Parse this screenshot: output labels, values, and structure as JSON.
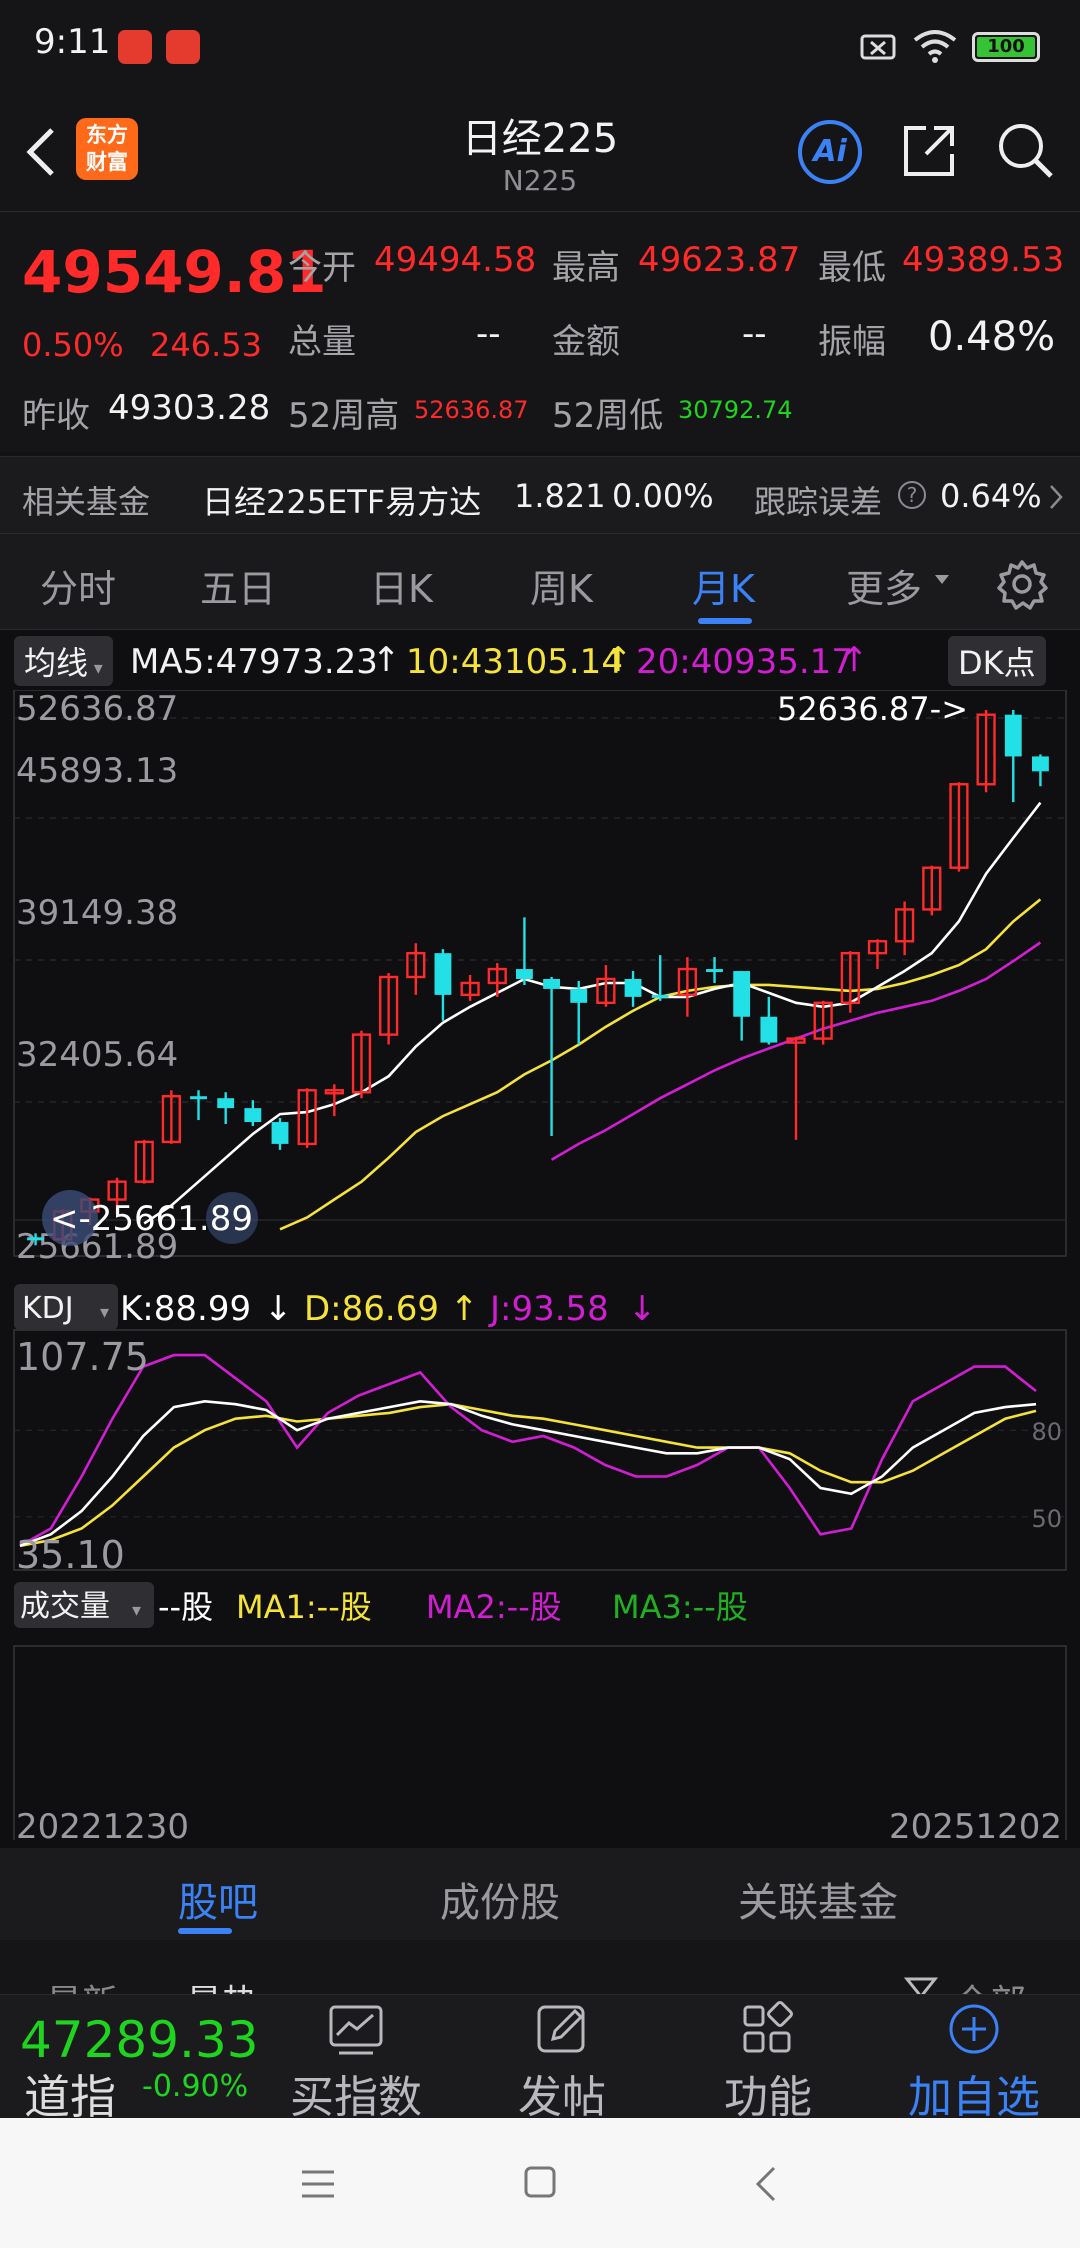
{
  "status_bar": {
    "time": "9:11",
    "battery": "100"
  },
  "header": {
    "title": "日经225",
    "subtitle": "N225",
    "logo_text": "东方财富",
    "ai_label": "Ai"
  },
  "quote": {
    "price": "49549.81",
    "change_pct": "0.50%",
    "change_abs": "246.53",
    "prev_close_label": "昨收",
    "prev_close": "49303.28",
    "open_label": "今开",
    "open": "49494.58",
    "high_label": "最高",
    "high": "49623.87",
    "low_label": "最低",
    "low": "49389.53",
    "volume_label": "总量",
    "volume": "--",
    "amount_label": "金额",
    "amount": "--",
    "amplitude_label": "振幅",
    "amplitude": "0.48%",
    "week52_high_label": "52周高",
    "week52_high": "52636.87",
    "week52_low_label": "52周低",
    "week52_low": "30792.74"
  },
  "fund": {
    "label": "相关基金",
    "name": "日经225ETF易方达",
    "price": "1.821",
    "change": "0.00%",
    "tracking_label": "跟踪误差",
    "tracking": "0.64%"
  },
  "tabs": [
    "分时",
    "五日",
    "日K",
    "周K",
    "月K",
    "更多"
  ],
  "active_tab": "月K",
  "chart": {
    "ma_pill": "均线",
    "ma5": "MA5:47973.23",
    "ma10": "10:43105.14",
    "ma20": "20:40935.17",
    "dk_button": "DK点",
    "y_labels": [
      "52636.87",
      "45893.13",
      "39149.38",
      "32405.64",
      "25661.89"
    ],
    "max_marker": "52636.87->",
    "min_marker": "<-25661.89",
    "kdj_pill": "KDJ",
    "kdj_k": "K:88.99",
    "kdj_d": "D:86.69",
    "kdj_j": "J:93.58",
    "kdj_top": "107.75",
    "kdj_bottom": "35.10",
    "kdj_80": "80",
    "kdj_50": "50",
    "vol_pill": "成交量",
    "vol_val": "--股",
    "vol_ma1": "MA1:--股",
    "vol_ma2": "MA2:--股",
    "vol_ma3": "MA3:--股",
    "date_start": "20221230",
    "date_end": "20251202",
    "colors": {
      "up": "#ff2a2a",
      "down": "#22e0e6",
      "ma5": "#ffffff",
      "ma10": "#f5e33a",
      "ma20": "#d21ed2"
    }
  },
  "chart_data": {
    "type": "candlestick",
    "period": "monthly",
    "x_range": [
      "20221230",
      "20251202"
    ],
    "ylim": [
      25661.89,
      52636.87
    ],
    "candles": [
      {
        "o": 26100,
        "h": 26300,
        "l": 25700,
        "c": 26000,
        "dir": "down"
      },
      {
        "o": 26000,
        "h": 27500,
        "l": 25900,
        "c": 27400,
        "dir": "up"
      },
      {
        "o": 27400,
        "h": 28100,
        "l": 26700,
        "c": 28000,
        "dir": "up"
      },
      {
        "o": 28000,
        "h": 29100,
        "l": 27300,
        "c": 28900,
        "dir": "up"
      },
      {
        "o": 28900,
        "h": 31000,
        "l": 28800,
        "c": 30900,
        "dir": "up"
      },
      {
        "o": 30900,
        "h": 33500,
        "l": 30800,
        "c": 33200,
        "dir": "up"
      },
      {
        "o": 33200,
        "h": 33500,
        "l": 32000,
        "c": 33100,
        "dir": "down"
      },
      {
        "o": 33100,
        "h": 33400,
        "l": 31800,
        "c": 32600,
        "dir": "down"
      },
      {
        "o": 32600,
        "h": 33000,
        "l": 31700,
        "c": 31900,
        "dir": "down"
      },
      {
        "o": 31900,
        "h": 32100,
        "l": 30500,
        "c": 30800,
        "dir": "down"
      },
      {
        "o": 30800,
        "h": 33600,
        "l": 30600,
        "c": 33500,
        "dir": "up"
      },
      {
        "o": 33500,
        "h": 33800,
        "l": 32200,
        "c": 33400,
        "dir": "up"
      },
      {
        "o": 33400,
        "h": 36500,
        "l": 33100,
        "c": 36300,
        "dir": "up"
      },
      {
        "o": 36300,
        "h": 39400,
        "l": 35800,
        "c": 39200,
        "dir": "up"
      },
      {
        "o": 39200,
        "h": 40900,
        "l": 38300,
        "c": 40400,
        "dir": "up"
      },
      {
        "o": 40400,
        "h": 40600,
        "l": 37000,
        "c": 38300,
        "dir": "down"
      },
      {
        "o": 38300,
        "h": 39300,
        "l": 38000,
        "c": 38900,
        "dir": "up"
      },
      {
        "o": 38900,
        "h": 39900,
        "l": 38200,
        "c": 39600,
        "dir": "up"
      },
      {
        "o": 39600,
        "h": 42200,
        "l": 38800,
        "c": 39100,
        "dir": "down"
      },
      {
        "o": 39100,
        "h": 39200,
        "l": 31200,
        "c": 38600,
        "dir": "down"
      },
      {
        "o": 38600,
        "h": 39000,
        "l": 35800,
        "c": 37900,
        "dir": "down"
      },
      {
        "o": 37900,
        "h": 39800,
        "l": 37700,
        "c": 39100,
        "dir": "up"
      },
      {
        "o": 39100,
        "h": 39500,
        "l": 37700,
        "c": 38200,
        "dir": "down"
      },
      {
        "o": 38200,
        "h": 40300,
        "l": 38000,
        "c": 38300,
        "dir": "down"
      },
      {
        "o": 38300,
        "h": 40200,
        "l": 37200,
        "c": 39600,
        "dir": "up"
      },
      {
        "o": 39600,
        "h": 40200,
        "l": 38900,
        "c": 39500,
        "dir": "down"
      },
      {
        "o": 39500,
        "h": 39500,
        "l": 36000,
        "c": 37200,
        "dir": "down"
      },
      {
        "o": 37200,
        "h": 38200,
        "l": 35800,
        "c": 35900,
        "dir": "down"
      },
      {
        "o": 35900,
        "h": 36200,
        "l": 31000,
        "c": 36100,
        "dir": "up"
      },
      {
        "o": 36100,
        "h": 38000,
        "l": 35800,
        "c": 37900,
        "dir": "up"
      },
      {
        "o": 37900,
        "h": 40500,
        "l": 37400,
        "c": 40400,
        "dir": "up"
      },
      {
        "o": 40400,
        "h": 41100,
        "l": 39600,
        "c": 41000,
        "dir": "up"
      },
      {
        "o": 41000,
        "h": 43000,
        "l": 40300,
        "c": 42600,
        "dir": "up"
      },
      {
        "o": 42600,
        "h": 44800,
        "l": 42300,
        "c": 44700,
        "dir": "up"
      },
      {
        "o": 44700,
        "h": 49000,
        "l": 44500,
        "c": 48900,
        "dir": "up"
      },
      {
        "o": 48900,
        "h": 52636.87,
        "l": 48500,
        "c": 52400,
        "dir": "up"
      },
      {
        "o": 52400,
        "h": 52636.87,
        "l": 48000,
        "c": 50300,
        "dir": "down"
      },
      {
        "o": 50300,
        "h": 50400,
        "l": 48800,
        "c": 49549.81,
        "dir": "down"
      }
    ],
    "ma5": [
      null,
      null,
      null,
      null,
      26800,
      27700,
      28900,
      30100,
      31300,
      32300,
      32400,
      32800,
      33400,
      34200,
      35700,
      36900,
      37700,
      38400,
      39100,
      38700,
      38600,
      38900,
      38900,
      38200,
      38200,
      38600,
      38900,
      38400,
      37900,
      37700,
      37900,
      38700,
      39500,
      40400,
      42000,
      44400,
      46200,
      47973.23
    ],
    "ma10": [
      null,
      null,
      null,
      null,
      null,
      null,
      null,
      null,
      null,
      26500,
      27100,
      28000,
      28900,
      30100,
      31400,
      32200,
      32800,
      33400,
      34300,
      35000,
      35800,
      36700,
      37500,
      38200,
      38500,
      38700,
      38800,
      38800,
      38700,
      38600,
      38500,
      38600,
      38900,
      39300,
      39800,
      40600,
      42000,
      43105.14
    ],
    "ma20": [
      null,
      null,
      null,
      null,
      null,
      null,
      null,
      null,
      null,
      null,
      null,
      null,
      null,
      null,
      null,
      null,
      null,
      null,
      null,
      30000,
      30800,
      31500,
      32300,
      33100,
      33800,
      34500,
      35100,
      35600,
      36100,
      36600,
      37000,
      37400,
      37700,
      38000,
      38500,
      39100,
      40000,
      40935.17
    ],
    "kdj": {
      "k": [
        40,
        44,
        52,
        64,
        78,
        88,
        90,
        89,
        87,
        80,
        84,
        86,
        88,
        90,
        89,
        85,
        82,
        80,
        78,
        76,
        74,
        72,
        72,
        74,
        74,
        70,
        60,
        58,
        64,
        74,
        80,
        86,
        88,
        88.99
      ],
      "d": [
        40,
        42,
        46,
        54,
        64,
        74,
        80,
        84,
        85,
        83,
        84,
        85,
        86,
        88,
        89,
        87,
        85,
        84,
        82,
        80,
        78,
        76,
        74,
        74,
        74,
        72,
        66,
        62,
        62,
        66,
        72,
        78,
        84,
        86.69
      ],
      "j": [
        40,
        46,
        64,
        84,
        102,
        106,
        106,
        98,
        90,
        74,
        86,
        92,
        96,
        100,
        88,
        80,
        76,
        78,
        74,
        68,
        64,
        64,
        68,
        74,
        74,
        60,
        44,
        46,
        70,
        90,
        96,
        102,
        102,
        93.58
      ]
    }
  },
  "sub_tabs": [
    "股吧",
    "成份股",
    "关联基金"
  ],
  "active_sub_tab": "股吧",
  "peek_row": {
    "left1": "最新",
    "left2": "最热",
    "right": "全部"
  },
  "action_bar": {
    "index_price": "47289.33",
    "index_name": "道指",
    "index_change": "-0.90%",
    "items": [
      "买指数",
      "发帖",
      "功能",
      "加自选"
    ]
  }
}
